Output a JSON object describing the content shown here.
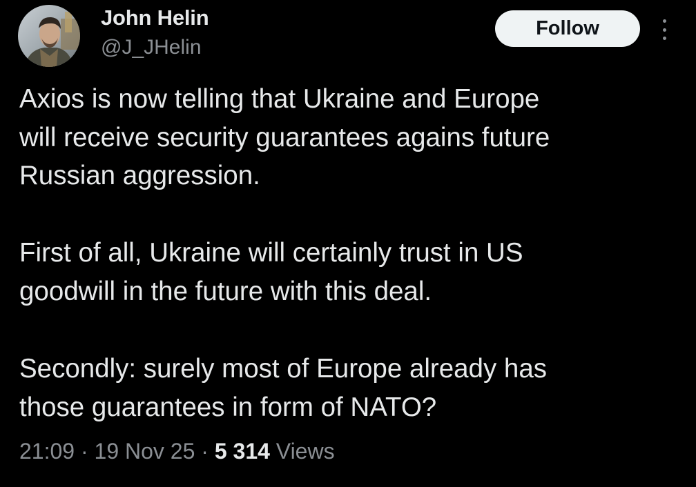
{
  "author": {
    "display_name": "John Helin",
    "handle": "@J_JHelin"
  },
  "follow_button": {
    "label": "Follow"
  },
  "tweet": {
    "paragraphs": [
      [
        "Axios is now telling that Ukraine and Europe",
        "will receive security guarantees agains future",
        "Russian aggression."
      ],
      [
        "First of all, Ukraine will certainly trust in US",
        "goodwill in the future with this deal."
      ],
      [
        "Secondly: surely most of Europe already has",
        "those guarantees in form of NATO?"
      ]
    ]
  },
  "meta": {
    "time": "21:09",
    "separator": "·",
    "date": "19 Nov 25",
    "views_count": "5 314",
    "views_label": "Views"
  },
  "icons": {
    "more": "more-vertical-icon",
    "avatar": "user-avatar"
  },
  "colors": {
    "background": "#000000",
    "primary_text": "#e7e9ea",
    "secondary_text": "#8b8f94",
    "follow_bg": "#eff3f4",
    "follow_text": "#0f1419"
  }
}
